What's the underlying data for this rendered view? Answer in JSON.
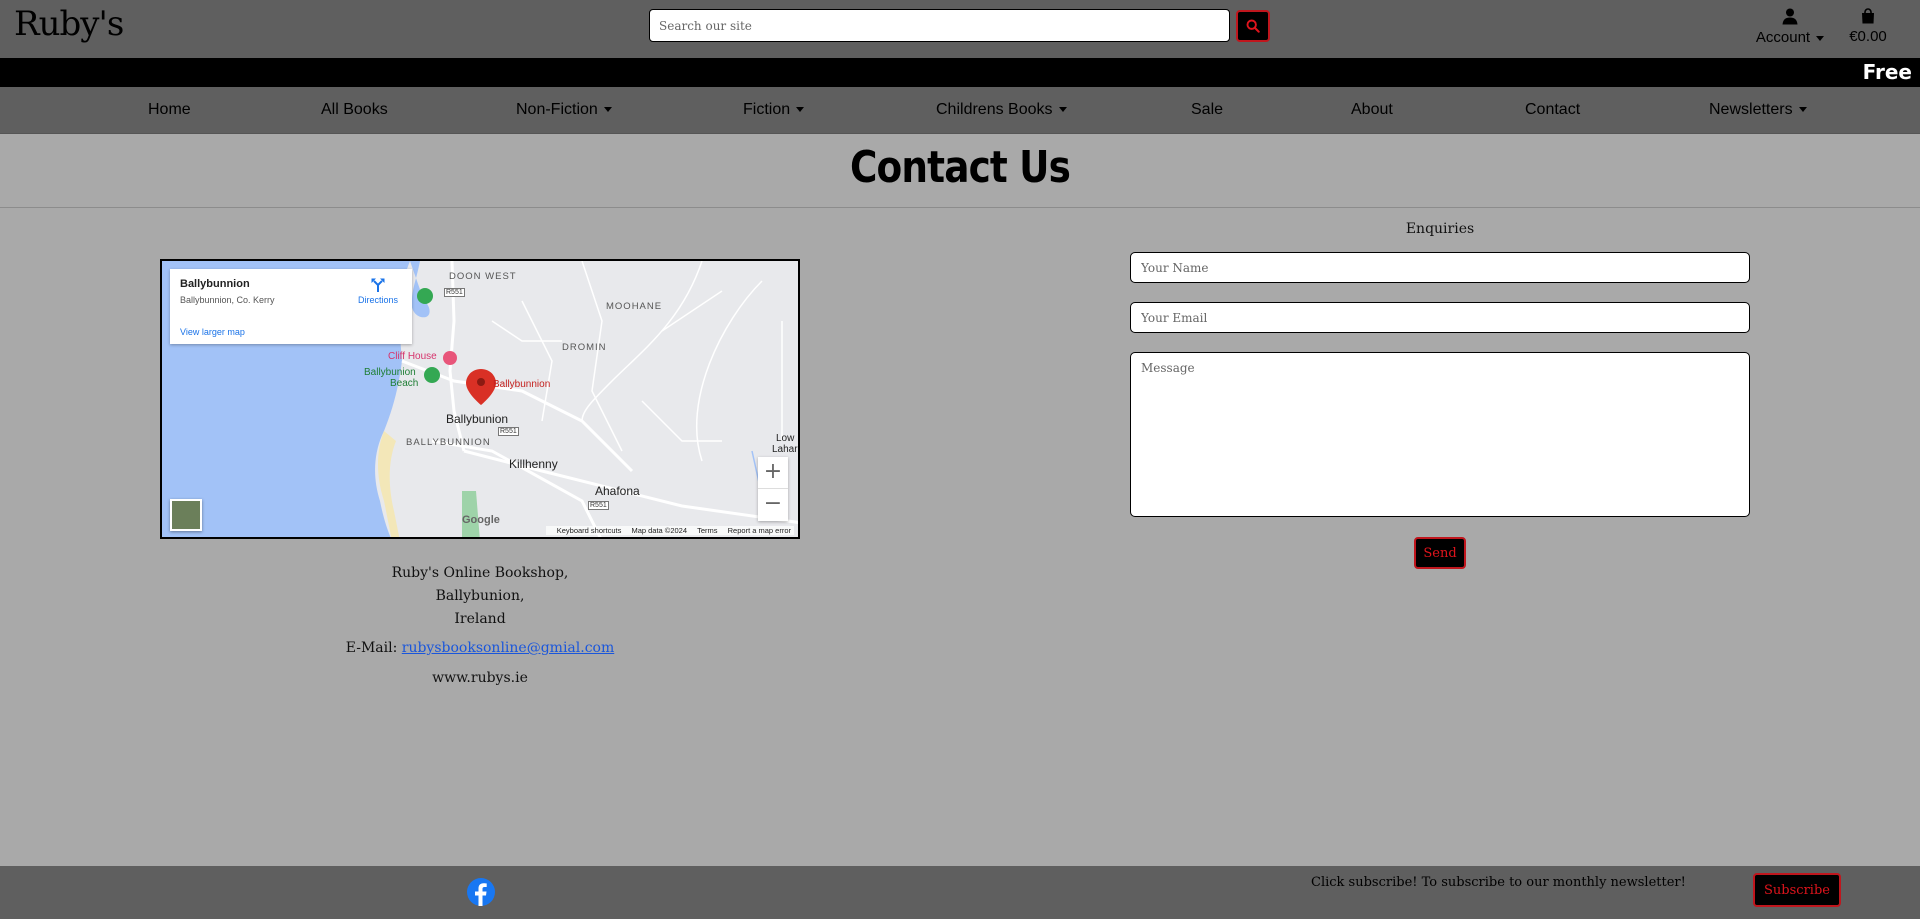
{
  "header": {
    "logo": "Ruby's",
    "search": {
      "placeholder": "Search our site",
      "value": ""
    },
    "search_icon": "magnifier-icon",
    "account_label": "Account",
    "account_icon": "user-icon",
    "cart_total": "€0.00",
    "cart_icon": "shopping-bag-icon"
  },
  "promo": {
    "text": "Free"
  },
  "nav": {
    "items": [
      {
        "label": "Home",
        "dropdown": false
      },
      {
        "label": "All Books",
        "dropdown": false
      },
      {
        "label": "Non-Fiction",
        "dropdown": true
      },
      {
        "label": "Fiction",
        "dropdown": true
      },
      {
        "label": "Childrens Books",
        "dropdown": true
      },
      {
        "label": "Sale",
        "dropdown": false
      },
      {
        "label": "About",
        "dropdown": false
      },
      {
        "label": "Contact",
        "dropdown": false
      },
      {
        "label": "Newsletters",
        "dropdown": true
      }
    ]
  },
  "page": {
    "title": "Contact Us"
  },
  "map": {
    "place_name": "Ballybunnion",
    "place_address": "Ballybunnion, Co. Kerry",
    "directions_label": "Directions",
    "larger_map_label": "View larger map",
    "labels": {
      "doon_west": "DOON WEST",
      "moohane": "MOOHANE",
      "dromin": "DROMIN",
      "cliff_house": "Cliff House",
      "beach_line1": "Ballybunion",
      "beach_line2": "Beach",
      "pin_label": "Ballybunnion",
      "town": "Ballybunion",
      "town_caps": "BALLYBUNNION",
      "killhenny": "Killhenny",
      "ahafona": "Ahafona",
      "low_line1": "Low",
      "low_line2": "Lahard",
      "road_r551a": "R551",
      "road_r551b": "R551",
      "road_r551c": "R551"
    },
    "zoom_in": "+",
    "zoom_out": "−",
    "google": "Google",
    "footer": {
      "shortcuts": "Keyboard shortcuts",
      "map_data": "Map data ©2024",
      "terms": "Terms",
      "report": "Report a map error"
    }
  },
  "contact": {
    "address_line1": "Ruby's Online Bookshop,",
    "address_line2": "Ballybunion,",
    "address_line3": "Ireland",
    "email_label": "E-Mail: ",
    "email": "rubysbooksonline@gmial.com",
    "website": "www.rubys.ie"
  },
  "form": {
    "title": "Enquiries",
    "name_placeholder": "Your Name",
    "email_placeholder": "Your Email",
    "message_placeholder": "Message",
    "send_label": "Send"
  },
  "footer": {
    "facebook_icon": "facebook-icon",
    "subscribe_text": "Click subscribe! To subscribe to our monthly newsletter!",
    "subscribe_label": "Subscribe"
  },
  "colors": {
    "header_bg": "#5f5f5f",
    "page_bg": "#a9a9a9",
    "accent_red": "#c0161d",
    "link_blue": "#1a56db",
    "facebook_blue": "#1877f2"
  }
}
